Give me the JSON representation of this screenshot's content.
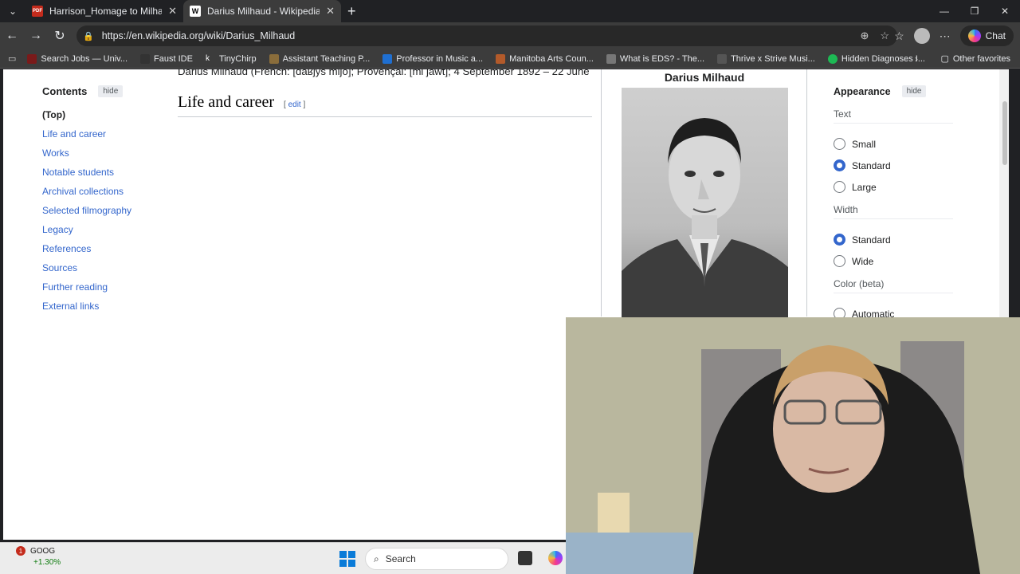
{
  "browser": {
    "tabs": [
      {
        "title": "Harrison_Homage to Milhaud.pdf",
        "favicon": "PDF",
        "active": false
      },
      {
        "title": "Darius Milhaud - Wikipedia",
        "favicon": "W",
        "active": true
      }
    ],
    "url": "https://en.wikipedia.org/wiki/Darius_Milhaud",
    "chat_label": "Chat",
    "bookmarks": [
      "Search Jobs — Univ...",
      "Faust IDE",
      "TinyChirp",
      "Assistant Teaching P...",
      "Professor in Music a...",
      "Manitoba Arts Coun...",
      "What is EDS? - The...",
      "Thrive x Strive Musi...",
      "Hidden Diagnoses I..."
    ],
    "other_favorites": "Other favorites"
  },
  "toc": {
    "title": "Contents",
    "hide": "hide",
    "items": [
      "(Top)",
      "Life and career",
      "Works",
      "Notable students",
      "Archival collections",
      "Selected filmography",
      "Legacy",
      "References",
      "Sources",
      "Further reading",
      "External links"
    ]
  },
  "article": {
    "intro_top": "Darius Milhaud (French: [daʁjys mijo]; Provençal: [mi jawt]; 4 September 1892 – 22 June",
    "section_title": "Life and career",
    "edit_label": "edit"
  },
  "infobox": {
    "title": "Darius Milhaud"
  },
  "appearance": {
    "title": "Appearance",
    "hide": "hide",
    "text_label": "Text",
    "text_options": [
      "Small",
      "Standard",
      "Large"
    ],
    "text_selected": "Standard",
    "width_label": "Width",
    "width_options": [
      "Standard",
      "Wide"
    ],
    "width_selected": "Standard",
    "color_label": "Color (beta)",
    "color_options": [
      "Automatic"
    ]
  },
  "taskbar": {
    "stock_symbol": "GOOG",
    "stock_change": "+1.30%",
    "stock_badge": "1",
    "search_placeholder": "Search"
  },
  "colors": {
    "link": "#3366cc",
    "text": "#202122",
    "chrome_dark": "#202124",
    "chrome_mid": "#3c3c3c"
  }
}
